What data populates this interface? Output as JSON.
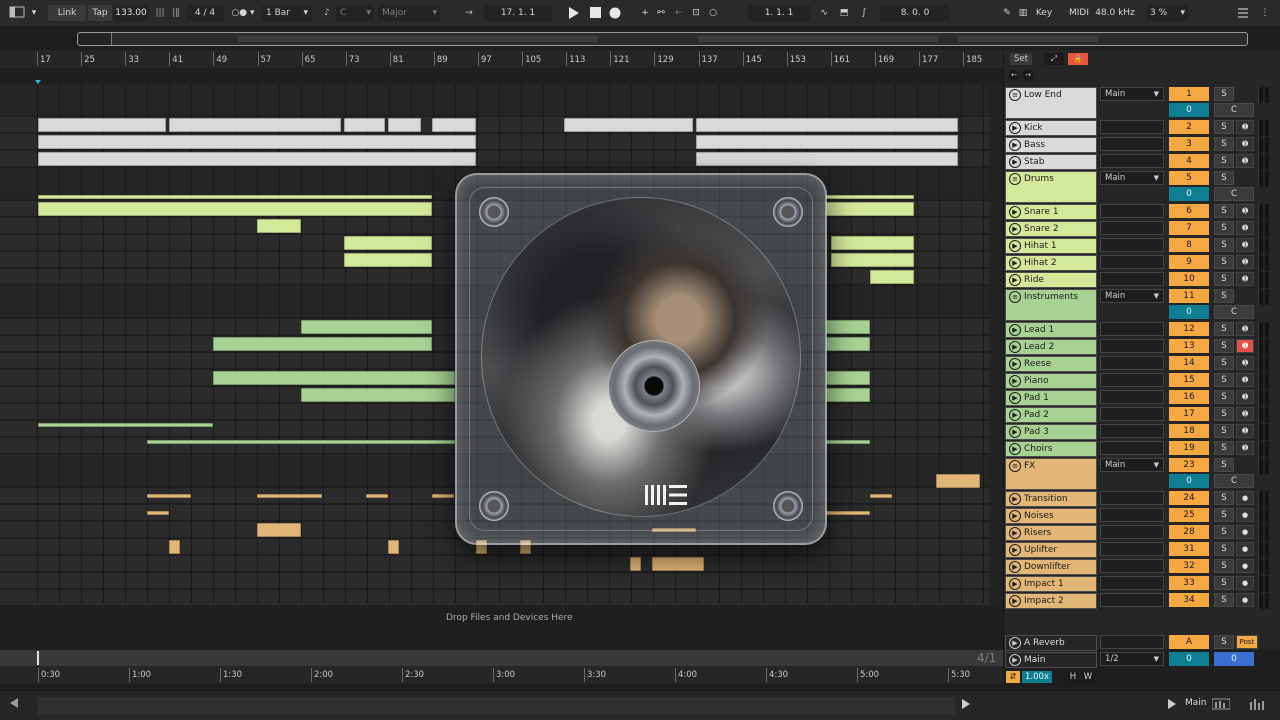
{
  "transport": {
    "link": "Link",
    "tap": "Tap",
    "tempo": "133.00",
    "signature": "4 / 4",
    "quantize": "1 Bar",
    "key": "C",
    "scale": "Major",
    "position": "17.  1.  1",
    "loop_start": "1.  1.  1",
    "loop_length": "8.  0.  0",
    "key_btn": "Key",
    "midi_btn": "MIDI",
    "sample_rate": "48.0 kHz",
    "cpu": "3 %"
  },
  "ruler": [
    "17",
    "25",
    "33",
    "41",
    "49",
    "57",
    "65",
    "73",
    "81",
    "89",
    "97",
    "105",
    "113",
    "121",
    "129",
    "137",
    "145",
    "153",
    "161",
    "169",
    "177",
    "185"
  ],
  "time_ruler": [
    "0:30",
    "1:00",
    "1:30",
    "2:00",
    "2:30",
    "3:00",
    "3:30",
    "4:00",
    "4:30",
    "5:00",
    "5:30"
  ],
  "loop_position": "4/1",
  "drop_text": "Drop Files and Devices Here",
  "colors": {
    "white_group": "#d9d9d9",
    "drums": "#d4e89a",
    "instruments": "#a7d293",
    "fx": "#e1b677",
    "accent_orange": "#f5a742",
    "teal": "#0e7e93",
    "arm_red": "#e6504a"
  },
  "mixer": {
    "set": "Set",
    "tracks": [
      {
        "name": "Low End",
        "type": "group",
        "route": "Main",
        "num": "1",
        "vol": "0",
        "color": "#d9d9d9"
      },
      {
        "name": "Kick",
        "type": "track",
        "num": "2",
        "color": "#d9d9d9"
      },
      {
        "name": "Bass",
        "type": "track",
        "num": "3",
        "color": "#d9d9d9"
      },
      {
        "name": "Stab",
        "type": "track",
        "num": "4",
        "color": "#d9d9d9"
      },
      {
        "name": "Drums",
        "type": "group",
        "route": "Main",
        "num": "5",
        "vol": "0",
        "color": "#d4e89a"
      },
      {
        "name": "Snare 1",
        "type": "track",
        "num": "6",
        "color": "#d4e89a"
      },
      {
        "name": "Snare 2",
        "type": "track",
        "num": "7",
        "color": "#d4e89a"
      },
      {
        "name": "Hihat 1",
        "type": "track",
        "num": "8",
        "color": "#d4e89a"
      },
      {
        "name": "Hihat 2",
        "type": "track",
        "num": "9",
        "color": "#d4e89a"
      },
      {
        "name": "Ride",
        "type": "track",
        "num": "10",
        "color": "#d4e89a"
      },
      {
        "name": "Instruments",
        "type": "group",
        "route": "Main",
        "num": "11",
        "vol": "0",
        "color": "#a7d293"
      },
      {
        "name": "Lead 1",
        "type": "track",
        "num": "12",
        "color": "#a7d293"
      },
      {
        "name": "Lead 2",
        "type": "track",
        "num": "13",
        "color": "#a7d293",
        "armed": true
      },
      {
        "name": "Reese",
        "type": "track",
        "num": "14",
        "color": "#a7d293"
      },
      {
        "name": "Piano",
        "type": "track",
        "num": "15",
        "color": "#a7d293"
      },
      {
        "name": "Pad 1",
        "type": "track",
        "num": "16",
        "color": "#a7d293"
      },
      {
        "name": "Pad 2",
        "type": "track",
        "num": "17",
        "color": "#a7d293"
      },
      {
        "name": "Pad 3",
        "type": "track",
        "num": "18",
        "color": "#a7d293"
      },
      {
        "name": "Choirs",
        "type": "track",
        "num": "19",
        "color": "#a7d293"
      },
      {
        "name": "FX",
        "type": "group",
        "route": "Main",
        "num": "23",
        "vol": "0",
        "color": "#e1b677"
      },
      {
        "name": "Transition",
        "type": "track",
        "num": "24",
        "color": "#e1b677"
      },
      {
        "name": "Noises",
        "type": "track",
        "num": "25",
        "color": "#e1b677"
      },
      {
        "name": "Risers",
        "type": "track",
        "num": "28",
        "color": "#e1b677"
      },
      {
        "name": "Uplifter",
        "type": "track",
        "num": "31",
        "color": "#e1b677"
      },
      {
        "name": "Downlifter",
        "type": "track",
        "num": "32",
        "color": "#e1b677"
      },
      {
        "name": "Impact 1",
        "type": "track",
        "num": "33",
        "color": "#e1b677"
      },
      {
        "name": "Impact 2",
        "type": "track",
        "num": "34",
        "color": "#e1b677"
      }
    ],
    "return_a": {
      "name": "A Reverb",
      "num": "A",
      "post": "Post"
    },
    "main": {
      "name": "Main",
      "route": "1/2",
      "vol": "0",
      "pan": "0"
    },
    "zoom": "1.00x",
    "h_btn": "H",
    "w_btn": "W",
    "solo": "S",
    "cue": "C"
  },
  "status": {
    "main_label": "Main"
  }
}
